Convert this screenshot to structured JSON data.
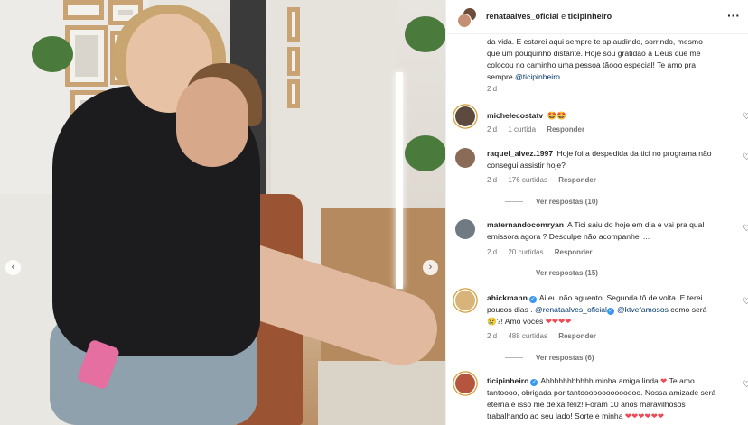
{
  "photo": {
    "nav_prev_icon": "chevron-left-icon",
    "nav_prev_glyph": "‹",
    "nav_next_icon": "chevron-right-icon",
    "nav_next_glyph": "›"
  },
  "header": {
    "user1": "renataalves_oficial",
    "joiner": " e ",
    "user2": "ticipinheiro",
    "more_glyph": "···"
  },
  "caption": {
    "text_1": "da vida. E estarei aqui sempre te aplaudindo, sorrindo, mesmo que um pouquinho distante. Hoje sou gratidão a Deus que me colocou no caminho uma pessoa tãooo especial! Te amo pra sempre ",
    "mention": "@ticipinheiro",
    "time": "2 d"
  },
  "comments": [
    {
      "user": "michelecostatv",
      "text": "🤩🤩",
      "time": "2 d",
      "likes": "1 curtida",
      "reply": "Responder",
      "avatar_color": "#5c4a3f"
    },
    {
      "user": "raquel_alvez.1997",
      "text": "Hoje foi a despedida da tici no programa não consegui assistir hoje?",
      "time": "2 d",
      "likes": "176 curtidas",
      "reply": "Responder",
      "view_replies": "Ver respostas (10)",
      "avatar_color": "#8a6b58"
    },
    {
      "user": "maternandocomryan",
      "text": "A Tici saiu do hoje em dia e vai pra qual emissora agora ? Desculpe não acompanhei ...",
      "time": "2 d",
      "likes": "20 curtidas",
      "reply": "Responder",
      "view_replies": "Ver respostas (15)",
      "avatar_color": "#6f7a83"
    },
    {
      "user": "ahickmann",
      "text_1": "Ai eu não aguento. Segunda tô de volta. E terei poucos dias . ",
      "mention_1": "@renataalves_oficial",
      "mention_2": "@ktvefamosos",
      "text_2": " como será",
      "text_3": "😢?! Amo vocês ",
      "hearts": "❤❤❤❤",
      "time": "2 d",
      "likes": "488 curtidas",
      "reply": "Responder",
      "view_replies": "Ver respostas (6)",
      "avatar_color": "#d8b37a"
    },
    {
      "user": "ticipinheiro",
      "text_1": "Ahhhhhhhhhhh minha amiga linda ",
      "heart_1": "❤",
      "text_2": " Te amo tantoooo, obrigada por tantoooooooooooooo. Nossa amizade será eterna e isso me deixa feliz! Foram 10 anos maravilhosos trabalhando ao seu lado! Sorte e minha ",
      "hearts": "❤❤❤❤❤❤",
      "avatar_color": "#b5553f"
    }
  ],
  "icons": {
    "heart_glyph": "♡",
    "verified_glyph": "✓"
  },
  "colors": {
    "mention": "#00376b",
    "verified": "#3897f0",
    "muted": "#737373",
    "heart_red": "#ed4956"
  }
}
